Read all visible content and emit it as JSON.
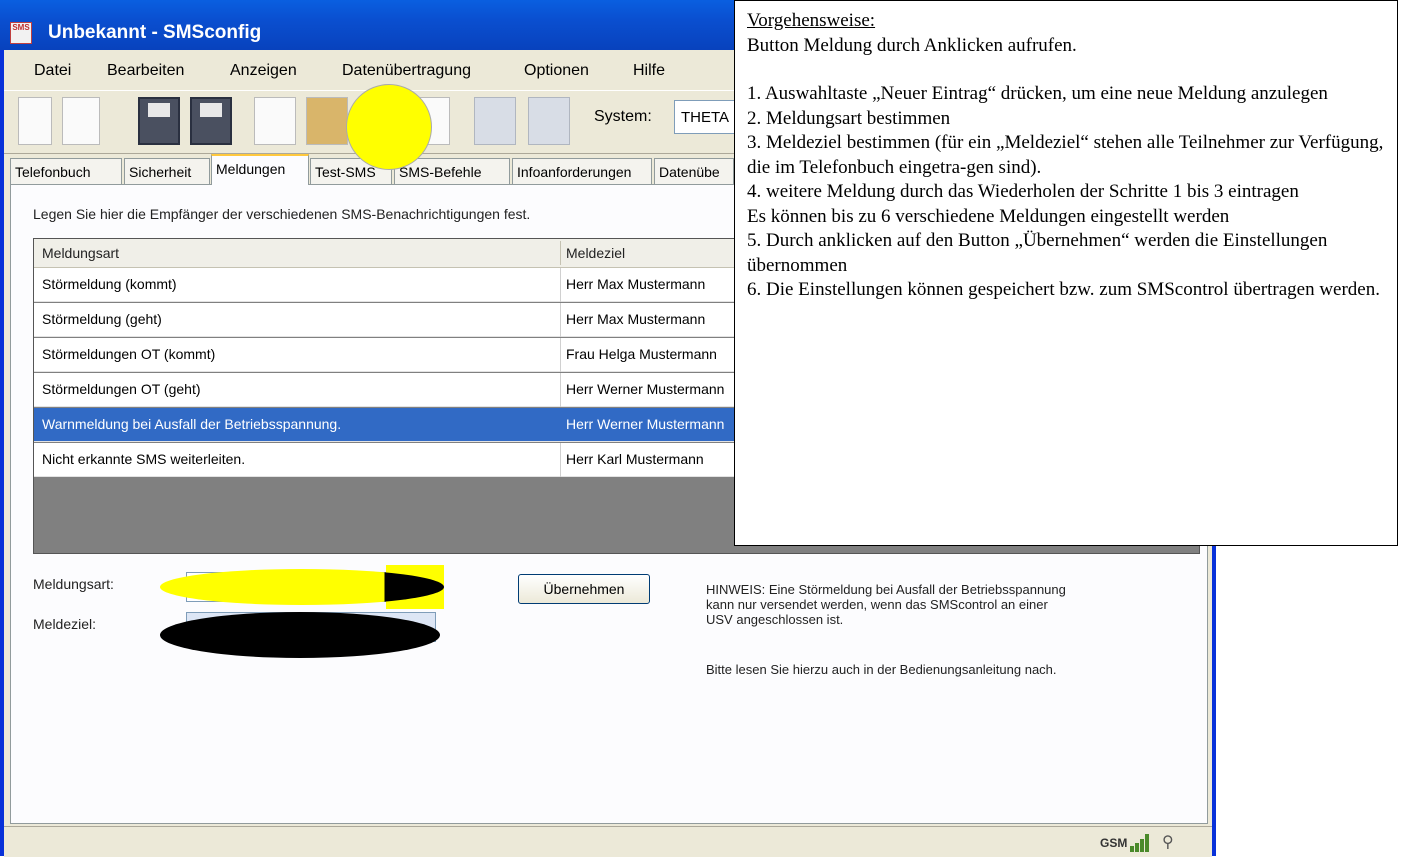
{
  "window": {
    "title": "Unbekannt - SMSconfig",
    "icon_text": "SMS"
  },
  "menu": [
    "Datei",
    "Bearbeiten",
    "Anzeigen",
    "Datenübertragung",
    "Optionen",
    "Hilfe"
  ],
  "toolbar": {
    "system_label": "System:",
    "system_value": "THETA"
  },
  "tabs": [
    "Telefonbuch",
    "Sicherheit",
    "Meldungen",
    "Test-SMS",
    "SMS-Befehle",
    "Infoanforderungen",
    "Datenübe"
  ],
  "meldungen": {
    "description": "Legen Sie hier die Empfänger der verschiedenen SMS-Benachrichtigungen fest.",
    "columns": [
      "Meldungsart",
      "Meldeziel"
    ],
    "rows": [
      {
        "art": "Störmeldung (kommt)",
        "ziel": "Herr Max Mustermann"
      },
      {
        "art": "Störmeldung (geht)",
        "ziel": "Herr Max Mustermann"
      },
      {
        "art": "Störmeldungen OT (kommt)",
        "ziel": "Frau Helga Mustermann"
      },
      {
        "art": "Störmeldungen OT (geht)",
        "ziel": "Herr Werner Mustermann"
      },
      {
        "art": "Warnmeldung bei Ausfall der Betriebsspannung.",
        "ziel": "Herr Werner Mustermann"
      },
      {
        "art": "Nicht erkannte SMS weiterleiten.",
        "ziel": "Herr Karl Mustermann"
      }
    ],
    "selected_row": 4,
    "form": {
      "meldungsart_label": "Meldungsart:",
      "meldeziel_label": "Meldeziel:",
      "apply_button": "Übernehmen"
    },
    "hint": [
      "HINWEIS: Eine Störmeldung bei Ausfall der Betriebsspannung",
      "kann nur versendet werden, wenn das SMScontrol an einer",
      "USV angeschlossen ist."
    ],
    "hint2": "Bitte lesen Sie hierzu auch in der Bedienungsanleitung nach."
  },
  "status": {
    "gsm": "GSM"
  },
  "note": {
    "heading": "Vorgehensweise:",
    "intro": "Button  Meldung durch Anklicken aufrufen.",
    "steps": [
      "1. Auswahltaste „Neuer Eintrag“ drücken, um eine neue Meldung anzulegen",
      "2. Meldungsart bestimmen",
      "3. Meldeziel bestimmen (für ein „Meldeziel“ stehen alle Teilnehmer zur Verfügung, die im Telefonbuch eingetra-gen sind).",
      "4. weitere Meldung durch das Wiederholen der Schritte 1 bis 3 eintragen",
      "Es können bis zu 6 verschiedene Meldungen eingestellt werden",
      "5. Durch anklicken auf den Button „Übernehmen“ werden die Einstellungen übernommen",
      "6. Die Einstellungen können gespeichert bzw. zum SMScontrol übertragen werden."
    ]
  },
  "colors": {
    "titlebar": "#0a50d0",
    "selection": "#316ac5",
    "highlight_yellow": "#ffff00",
    "redaction": "#000000"
  }
}
